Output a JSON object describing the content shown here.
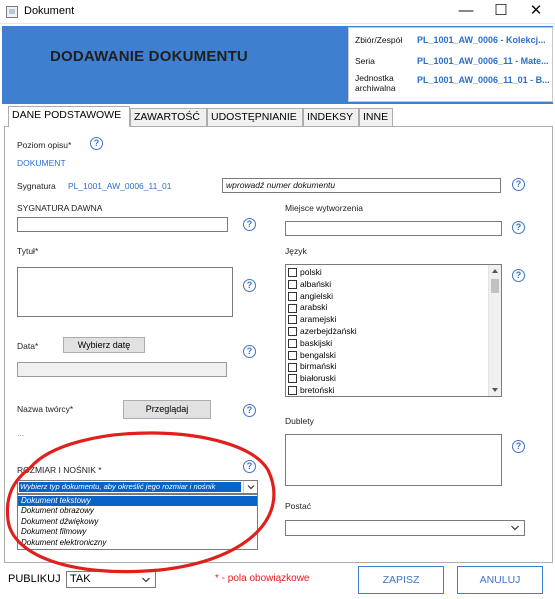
{
  "window": {
    "title": "Dokument",
    "minimize": "—",
    "maximize": "☐",
    "close": "✕"
  },
  "header": {
    "title": "DODAWANIE DOKUMENTU",
    "info": [
      {
        "label": "Zbiór/Zespół",
        "value": "PL_1001_AW_0006 - Kolekcj..."
      },
      {
        "label": "Seria",
        "value": "PL_1001_AW_0006_11 - Mate..."
      },
      {
        "label": "Jednostka archiwalna",
        "value": "PL_1001_AW_0006_11_01 - B..."
      }
    ]
  },
  "tabs": [
    "DANE PODSTAWOWE",
    "ZAWARTOŚĆ",
    "UDOSTĘPNIANIE",
    "INDEKSY",
    "INNE"
  ],
  "form": {
    "poziom_opisu_label": "Poziom opisu*",
    "poziom_opisu_value": "DOKUMENT",
    "sygnatura_label": "Sygnatura",
    "sygnatura_value": "PL_1001_AW_0006_11_01",
    "sygnatura_placeholder": "wprowadź numer dokumentu",
    "sygnatura_dawna_label": "SYGNATURA DAWNA",
    "miejsce_label": "Miejsce wytworzenia",
    "tytul_label": "Tytuł*",
    "jezyk_label": "Język",
    "data_label": "Data*",
    "wybierz_date": "Wybierz datę",
    "nazwa_tworcy_label": "Nazwa twórcy*",
    "przegladaj": "Przeglądaj",
    "ellipsis": "...",
    "dublety_label": "Dublety",
    "rozmiar_label": "ROZMIAR I NOŚNIK *",
    "rozmiar_placeholder": "Wybierz typ dokumentu, aby określić jego rozmiar i nośnik",
    "rozmiar_options": [
      "Dokument tekstowy",
      "Dokument obrazowy",
      "Dokument dźwiękowy",
      "Dokument filmowy",
      "Dokument elektroniczny"
    ],
    "postac_label": "Postać",
    "help_glyph": "?"
  },
  "languages": [
    "polski",
    "albański",
    "angielski",
    "arabski",
    "aramejski",
    "azerbejdżański",
    "baskijski",
    "bengalski",
    "birmański",
    "białoruski",
    "bretoński"
  ],
  "footer": {
    "publikuj_label": "PUBLIKUJ",
    "publikuj_value": "TAK",
    "required_note": "* - pola obowiązkowe",
    "save": "ZAPISZ",
    "cancel": "ANULUJ"
  },
  "colors": {
    "header_blue": "#3f7fd0",
    "link_blue": "#2a6fc9",
    "highlight": "#0a64c8",
    "required_red": "#e0201c",
    "annotation_red": "#e0201c"
  }
}
